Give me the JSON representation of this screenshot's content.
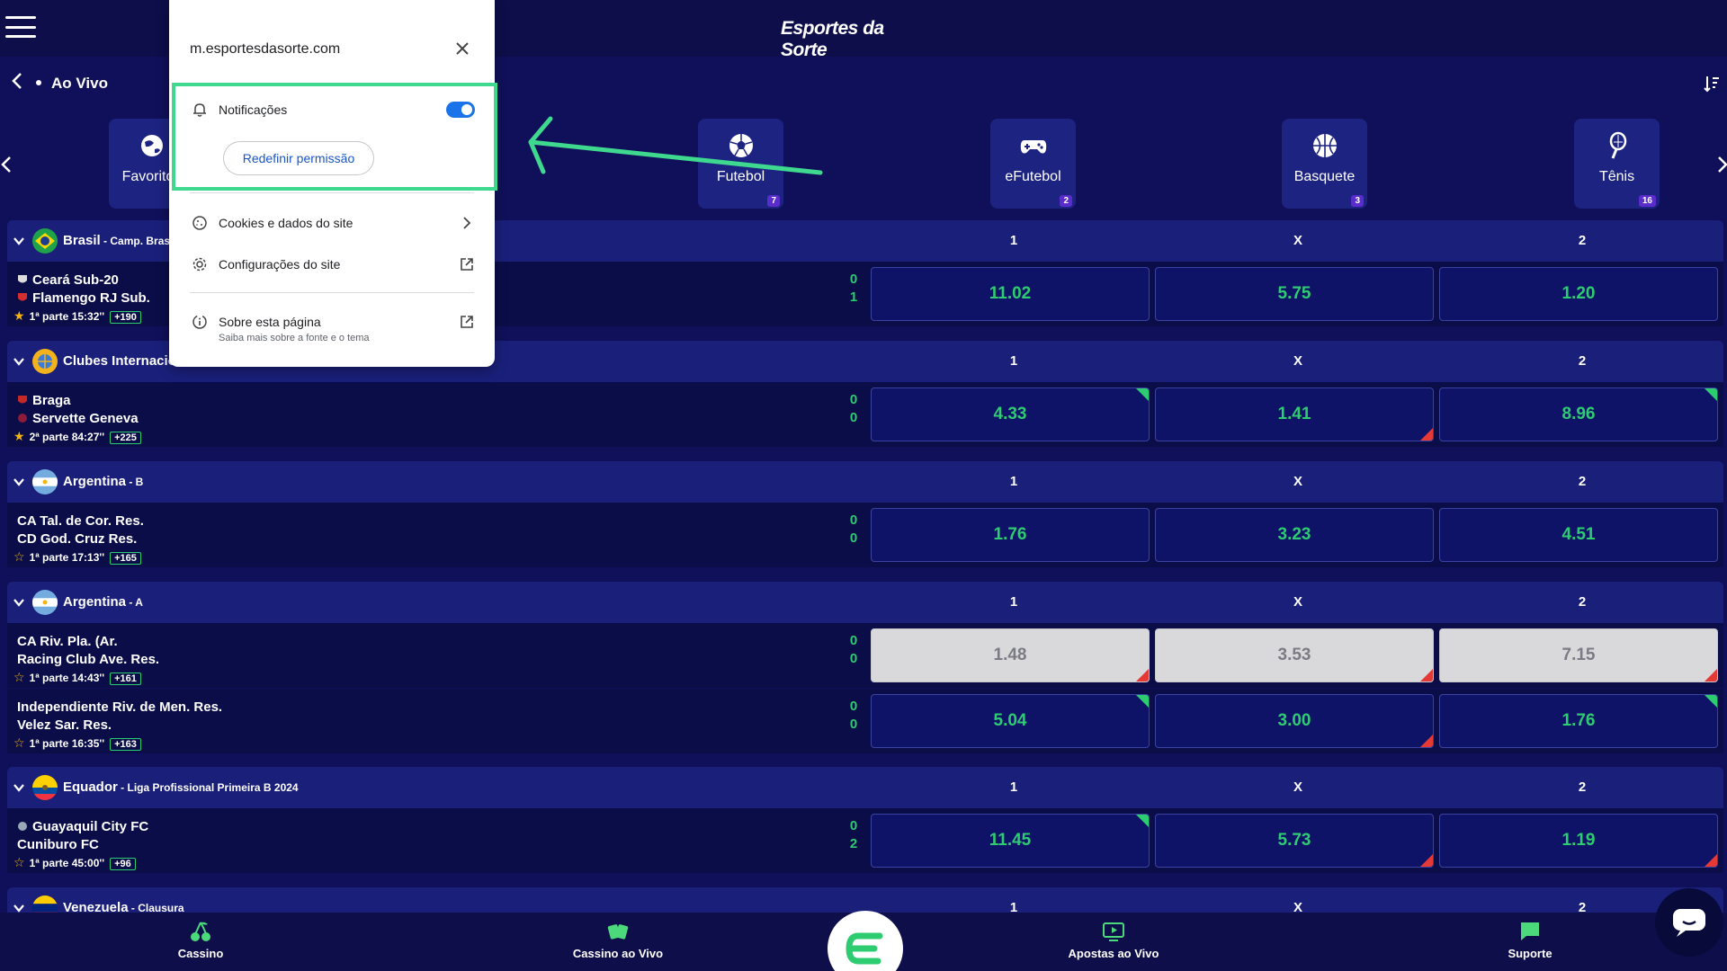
{
  "header": {
    "brand": "Esportes da Sorte"
  },
  "subheader": {
    "title": "Ao Vivo"
  },
  "sports": [
    {
      "label": "Favoritos",
      "count": ""
    },
    {
      "label": "Futebol",
      "count": "7"
    },
    {
      "label": "eFutebol",
      "count": "2"
    },
    {
      "label": "Basquete",
      "count": "3"
    },
    {
      "label": "Tênis",
      "count": "16"
    }
  ],
  "columns": {
    "home": "1",
    "draw": "X",
    "away": "2"
  },
  "leagues": [
    {
      "name": "Brasil",
      "sub": " - Camp. Brasileiro"
    },
    {
      "name": "Clubes Internacionais",
      "sub": ""
    },
    {
      "name": "Argentina",
      "sub": " - B"
    },
    {
      "name": "Argentina",
      "sub": " - A"
    },
    {
      "name": "Equador",
      "sub": " - Liga Profissional Primeira B 2024"
    },
    {
      "name": "Venezuela",
      "sub": " - Clausura"
    }
  ],
  "matches": [
    {
      "team1": "Ceará Sub-20",
      "team2": "Flamengo RJ Sub.",
      "time": "1ª parte 15:32''",
      "more": "+190",
      "score1": "0",
      "score2": "1",
      "odd1": "11.02",
      "oddx": "5.75",
      "odd2": "1.20"
    },
    {
      "team1": "Braga",
      "team2": "Servette Geneva",
      "time": "2ª parte 84:27''",
      "more": "+225",
      "score1": "0",
      "score2": "0",
      "odd1": "4.33",
      "oddx": "1.41",
      "odd2": "8.96"
    },
    {
      "team1": "CA Tal. de Cor. Res.",
      "team2": "CD God. Cruz Res.",
      "time": "1ª parte 17:13''",
      "more": "+165",
      "score1": "0",
      "score2": "0",
      "odd1": "1.76",
      "oddx": "3.23",
      "odd2": "4.51"
    },
    {
      "team1": "CA Riv. Pla. (Ar.",
      "team2": "Racing Club Ave. Res.",
      "time": "1ª parte 14:43''",
      "more": "+161",
      "score1": "0",
      "score2": "0",
      "odd1": "1.48",
      "oddx": "3.53",
      "odd2": "7.15"
    },
    {
      "team1": "Independiente Riv. de Men. Res.",
      "team2": "Velez Sar. Res.",
      "time": "1ª parte 16:35''",
      "more": "+163",
      "score1": "0",
      "score2": "0",
      "odd1": "5.04",
      "oddx": "3.00",
      "odd2": "1.76"
    },
    {
      "team1": "Guayaquil City FC",
      "team2": "Cuniburo FC",
      "time": "1ª parte 45:00''",
      "more": "+96",
      "score1": "0",
      "score2": "2",
      "odd1": "11.45",
      "oddx": "5.73",
      "odd2": "1.19"
    }
  ],
  "bottom_nav": [
    {
      "label": "Cassino"
    },
    {
      "label": "Cassino ao Vivo"
    },
    {
      "label": "Apostas ao Vivo"
    },
    {
      "label": "Suporte"
    }
  ],
  "popup": {
    "site": "m.esportesdasorte.com",
    "notifications": "Notificações",
    "reset": "Redefinir permissão",
    "cookies": "Cookies e dados do site",
    "settings": "Configurações do site",
    "about": "Sobre esta página",
    "about_sub": "Saiba mais sobre a fonte e o tema"
  },
  "colors": {
    "background": "#10105a",
    "odds_text": "#2ecc71",
    "accent": "#3ed88f",
    "toggle": "#1a73e8"
  }
}
